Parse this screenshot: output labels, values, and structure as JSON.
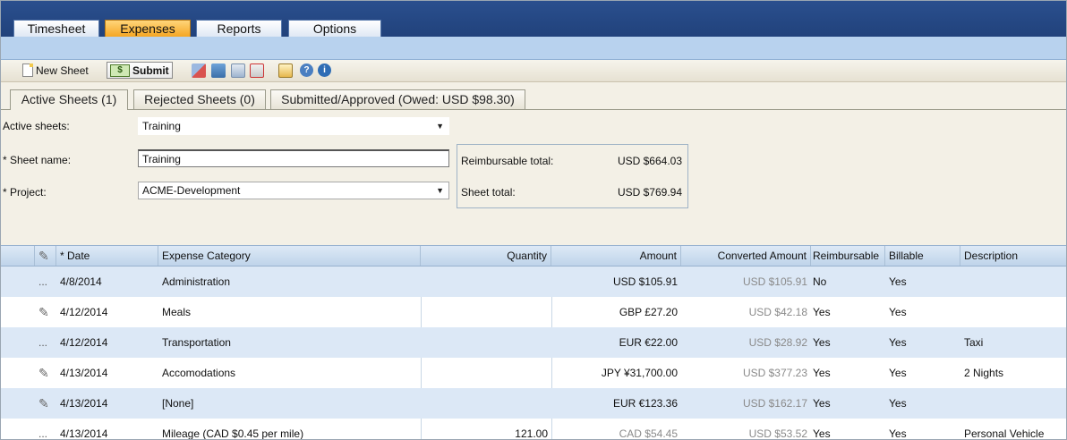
{
  "nav": {
    "tabs": [
      {
        "label": "Timesheet",
        "active": false
      },
      {
        "label": "Expenses",
        "active": true
      },
      {
        "label": "Reports",
        "active": false
      },
      {
        "label": "Options",
        "active": false
      }
    ]
  },
  "toolbar": {
    "new_sheet": "New Sheet",
    "submit": "Submit",
    "money_icon_text": "$"
  },
  "sheet_tabs": [
    {
      "label": "Active Sheets (1)",
      "active": true
    },
    {
      "label": "Rejected Sheets (0)",
      "active": false
    },
    {
      "label": "Submitted/Approved (Owed: USD $98.30)",
      "active": false
    }
  ],
  "form": {
    "active_sheets_label": "Active sheets:",
    "active_sheets_value": "Training",
    "sheet_name_label": "* Sheet name:",
    "sheet_name_value": "Training",
    "project_label": "* Project:",
    "project_value": "ACME-Development",
    "reimbursable_total_label": "Reimbursable total:",
    "reimbursable_total_value": "USD $664.03",
    "sheet_total_label": "Sheet total:",
    "sheet_total_value": "USD $769.94"
  },
  "grid": {
    "columns": {
      "date": "* Date",
      "category": "Expense Category",
      "quantity": "Quantity",
      "amount": "Amount",
      "converted": "Converted Amount",
      "reimbursable": "Reimbursable",
      "billable": "Billable",
      "description": "Description"
    },
    "rows": [
      {
        "marker": "...",
        "date": "4/8/2014",
        "category": "Administration",
        "quantity": "",
        "amount": "USD $105.91",
        "converted": "USD $105.91",
        "reimbursable": "No",
        "billable": "Yes",
        "description": ""
      },
      {
        "marker": "✎",
        "date": "4/12/2014",
        "category": "Meals",
        "quantity": "",
        "amount": "GBP £27.20",
        "converted": "USD $42.18",
        "reimbursable": "Yes",
        "billable": "Yes",
        "description": ""
      },
      {
        "marker": "...",
        "date": "4/12/2014",
        "category": "Transportation",
        "quantity": "",
        "amount": "EUR €22.00",
        "converted": "USD $28.92",
        "reimbursable": "Yes",
        "billable": "Yes",
        "description": "Taxi"
      },
      {
        "marker": "✎",
        "date": "4/13/2014",
        "category": "Accomodations",
        "quantity": "",
        "amount": "JPY ¥31,700.00",
        "converted": "USD $377.23",
        "reimbursable": "Yes",
        "billable": "Yes",
        "description": "2 Nights"
      },
      {
        "marker": "✎",
        "date": "4/13/2014",
        "category": "[None]",
        "quantity": "",
        "amount": "EUR €123.36",
        "converted": "USD $162.17",
        "reimbursable": "Yes",
        "billable": "Yes",
        "description": ""
      },
      {
        "marker": "...",
        "date": "4/13/2014",
        "category": "Mileage (CAD $0.45 per mile)",
        "quantity": "121.00",
        "amount": "CAD $54.45",
        "converted": "USD $53.52",
        "reimbursable": "Yes",
        "billable": "Yes",
        "description": "Personal Vehicle"
      }
    ]
  },
  "colors": {
    "nav_bg": "#2a4f8e",
    "nav_active": "#f5a623",
    "row_alt": "#dce8f6",
    "form_bg": "#f3f0e6"
  }
}
